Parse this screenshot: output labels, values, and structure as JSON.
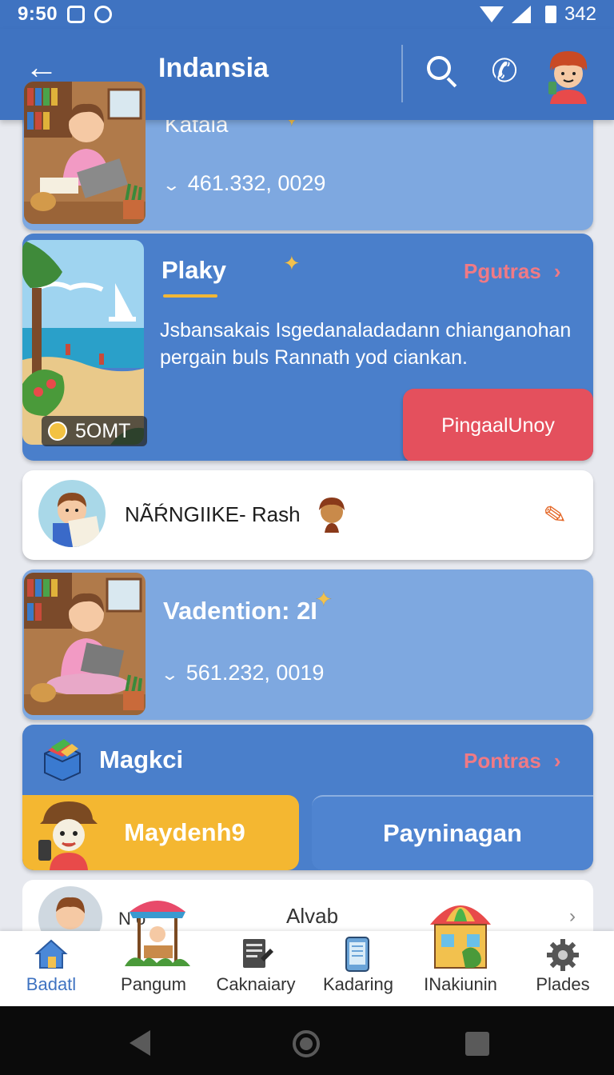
{
  "status_bar": {
    "time": "9:50",
    "battery": "342"
  },
  "app_bar": {
    "title": "Indansia"
  },
  "cards": {
    "top": {
      "title": "Kataia",
      "stat": "461.332, 0029"
    },
    "feature": {
      "title": "Plaky",
      "more_label": "Pgutras",
      "description_line1": "Jsbansakais Isgedanaladadann chianganohan",
      "description_line2": "pergain buls Rannath yod ciankan.",
      "cta_label": "PingaalUnoy",
      "price": "5OMT"
    },
    "profile": {
      "name": "NÃŔNGIIKE- Rash"
    },
    "valuation": {
      "title": "Vadention: 2I",
      "stat": "561.232, 0019"
    },
    "magic": {
      "title": "Magkci",
      "more_label": "Pontras",
      "primary_button": "Maydenh9",
      "secondary_button": "Payninagan"
    },
    "peek": {
      "label": "Alvab",
      "partial_label": "N      o"
    }
  },
  "bottom_nav": {
    "items": [
      {
        "label": "Badatl",
        "icon": "house-icon"
      },
      {
        "label": "Pangum",
        "icon": "market-stall-icon"
      },
      {
        "label": "Caknaiary",
        "icon": "document-icon"
      },
      {
        "label": "Kadaring",
        "icon": "phone-icon"
      },
      {
        "label": "INakiunin",
        "icon": "shop-icon"
      },
      {
        "label": "Plades",
        "icon": "gear-icon"
      }
    ]
  },
  "colors": {
    "primary": "#3f73c1",
    "card_light": "#7ea8e0",
    "card_dark": "#4a7fcb",
    "accent_red": "#e4505d",
    "accent_yellow": "#f4b731",
    "link_pink": "#f07a85"
  }
}
